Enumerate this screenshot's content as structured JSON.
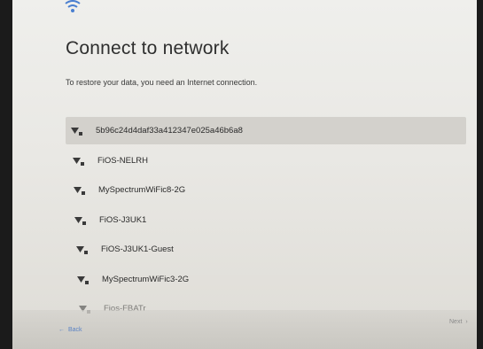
{
  "header": {
    "status_icon": "wifi-icon",
    "title": "Connect to network",
    "subtitle": "To restore your data, you need an Internet connection."
  },
  "networks": [
    {
      "ssid": "5b96c24d4daf33a412347e025a46b6a8",
      "icon": "wifi-lock-icon",
      "selected": true
    },
    {
      "ssid": "FiOS-NELRH",
      "icon": "wifi-lock-icon",
      "selected": false
    },
    {
      "ssid": "MySpectrumWiFic8-2G",
      "icon": "wifi-lock-icon",
      "selected": false
    },
    {
      "ssid": "FiOS-J3UK1",
      "icon": "wifi-lock-icon",
      "selected": false
    },
    {
      "ssid": "FiOS-J3UK1-Guest",
      "icon": "wifi-lock-icon",
      "selected": false
    },
    {
      "ssid": "MySpectrumWiFic3-2G",
      "icon": "wifi-lock-icon",
      "selected": false
    },
    {
      "ssid": "Fios-FBATr",
      "icon": "wifi-lock-icon",
      "selected": false
    }
  ],
  "footer": {
    "back_label": "Back",
    "next_label": "Next"
  },
  "colors": {
    "accent": "#5b83c4",
    "selected_row": "#d3d1cc"
  }
}
